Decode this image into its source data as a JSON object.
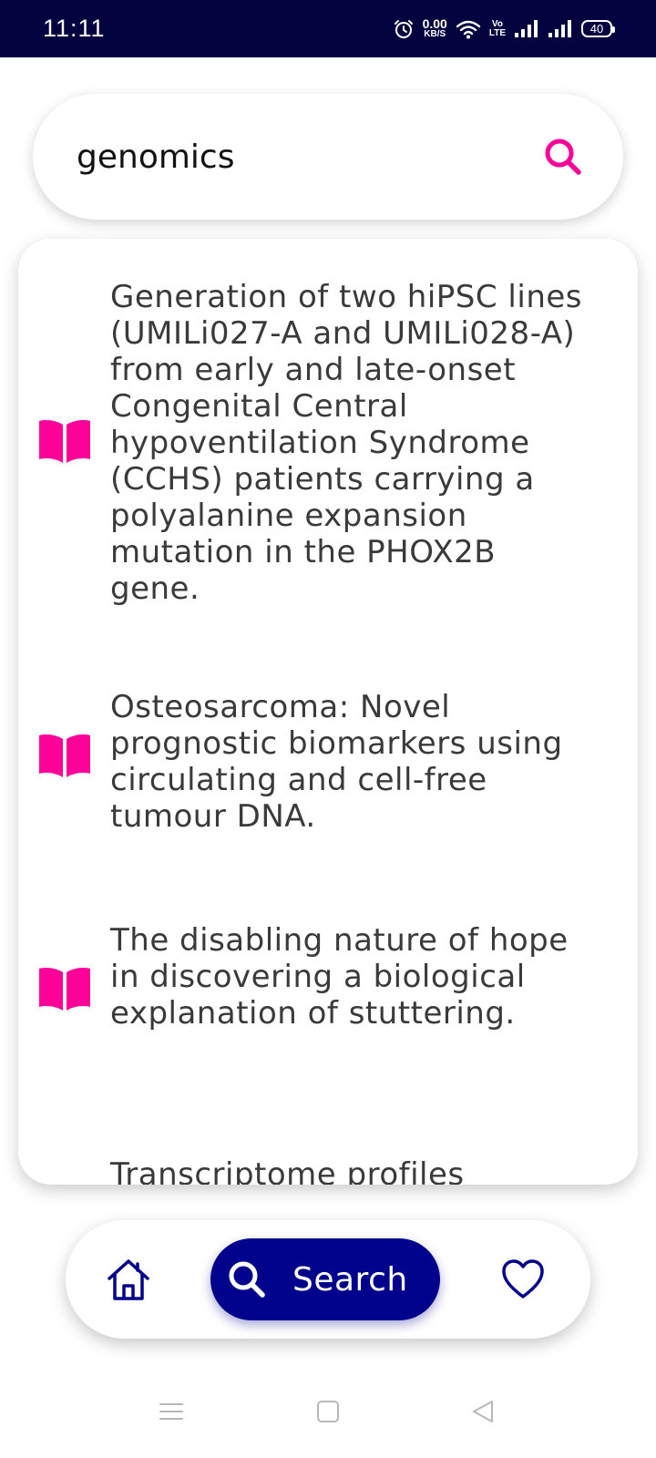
{
  "status_bar": {
    "time": "11:11",
    "net_speed_value": "0.00",
    "net_speed_unit": "KB/S",
    "volte_top": "Vo",
    "volte_bottom": "LTE",
    "battery": "40",
    "icons": [
      "alarm-icon",
      "wifi-icon",
      "volte-icon",
      "signal-icon",
      "signal-icon",
      "battery-icon"
    ]
  },
  "search": {
    "query": "genomics",
    "icon": "search-icon"
  },
  "results": [
    {
      "title": "Generation of two hiPSC lines (UMILi027-A and UMILi028-A) from early and late-onset Congenital Central hypoventilation Syndrome (CCHS) patients carrying a polyalanine expansion mutation in the PHOX2B gene.",
      "icon": "book-icon"
    },
    {
      "title": "Osteosarcoma: Novel prognostic biomarkers using circulating and cell-free tumour DNA.",
      "icon": "book-icon"
    },
    {
      "title": "The disabling nature of hope in discovering a biological explanation of stuttering.",
      "icon": "book-icon"
    },
    {
      "title": "Transcriptome profiles",
      "icon": "book-icon"
    }
  ],
  "bottom_nav": {
    "home_icon": "home-icon",
    "search_label": "Search",
    "search_icon": "search-icon",
    "favorites_icon": "heart-icon"
  },
  "colors": {
    "status_bar_bg": "#02033f",
    "accent_pink": "#ff0099",
    "nav_active_bg": "#02038c",
    "text": "#3a3a3a"
  }
}
